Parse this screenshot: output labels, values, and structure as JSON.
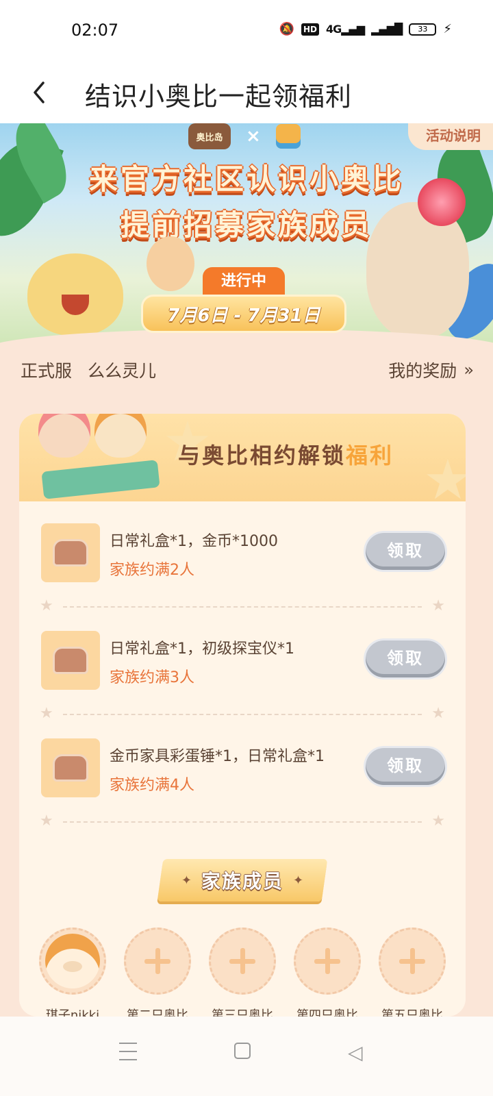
{
  "status_bar": {
    "time": "02:07",
    "icons": [
      "bell-off-icon",
      "hd-icon",
      "signal-4g-icon",
      "signal-bars-icon",
      "battery-icon",
      "charging-icon"
    ],
    "hd": "HD",
    "network": "4G",
    "battery": "33"
  },
  "header": {
    "back_icon": "chevron-left-icon",
    "title": "结识小奥比一起领福利"
  },
  "banner": {
    "activity_rules": "活动说明",
    "logo_left": "奥比岛",
    "logo_sep": "×",
    "title_line1": "来官方社区认识小奥比",
    "title_line2": "提前招募家族成员",
    "status": "进行中",
    "date_range": "7月6日 - 7月31日"
  },
  "server": {
    "label": "正式服",
    "name": "么么灵儿",
    "my_rewards": "我的奖励",
    "my_rewards_icon": "double-chevron-right-icon"
  },
  "rewards_card": {
    "title_main": "与奥比相约解锁",
    "title_highlight": "福利",
    "items": [
      {
        "name": "日常礼盒*1，金币*1000",
        "condition": "家族约满2人",
        "button": "领取",
        "icon": "chest-coins-icon"
      },
      {
        "name": "日常礼盒*1，初级探宝仪*1",
        "condition": "家族约满3人",
        "button": "领取",
        "icon": "chest-detector-icon"
      },
      {
        "name": "金币家具彩蛋锤*1，日常礼盒*1",
        "condition": "家族约满4人",
        "button": "领取",
        "icon": "chest-hammer-icon"
      }
    ],
    "family_title": "家族成员",
    "members": [
      {
        "name": "琪子nikki",
        "filled": true
      },
      {
        "name": "第二只奥比",
        "filled": false
      },
      {
        "name": "第三只奥比",
        "filled": false
      },
      {
        "name": "第四只奥比",
        "filled": false
      },
      {
        "name": "第五只奥比",
        "filled": false
      }
    ]
  },
  "colors": {
    "page_bg": "#fbe6d8",
    "card_bg": "#fff5e8",
    "accent_orange": "#e8743a",
    "button_disabled": "#c3c7cf",
    "highlight": "#f7a43a"
  },
  "nav_bar": {
    "icons": [
      "menu-icon",
      "home-square-icon",
      "back-triangle-icon"
    ]
  }
}
